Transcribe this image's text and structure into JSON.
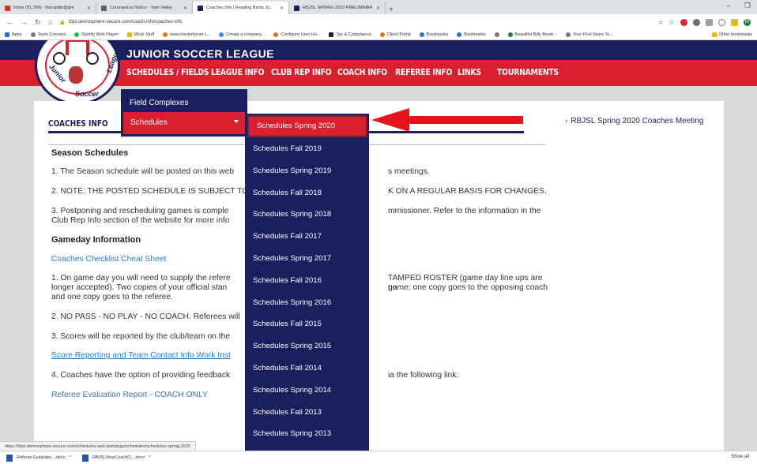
{
  "browser": {
    "tabs": [
      {
        "title": "Inbox (61,786) - theraddie@gm",
        "color": "#d93025"
      },
      {
        "title": "Coronavirus Notice - Twin Valley",
        "color": "#5f6368"
      },
      {
        "title": "Coaches Info | Reading Berks Ju",
        "color": "#1a1f5e",
        "active": true
      },
      {
        "title": "RBJSL SPRING 2020 PRELIMINAR",
        "color": "#1a1f5e"
      }
    ],
    "new_tab": "+",
    "url": "rbjsl.demosphere-secure.com/coach-info/coaches-info",
    "bookmarks": [
      "Apps",
      "Team Connect",
      "Spotify Web Player",
      "Work Stuff",
      "www.tractorbynet.c...",
      "Create a company...",
      "Configure User Ho...",
      "Tax & Compliance",
      "Client Portal",
      "Bookmarks",
      "Bookmarks",
      "Beautiful Billy Beste...",
      "Your First Steps To...",
      "Other bookmarks"
    ],
    "profile_initial": "M",
    "status_url": "https://rbjsl.demosphere-secure.com/schedules-and-standings/schedules/schedules-spring-2020",
    "downloads": [
      "Referee Evaluatio....docx",
      "RBJSLNewCoachO....docx"
    ],
    "show_all": "Show all"
  },
  "site": {
    "league_name": "JUNIOR SOCCER LEAGUE",
    "logo_text": {
      "junior": "Junior",
      "soccer": "Soccer",
      "league": "League"
    },
    "nav": [
      "SCHEDULES / FIELDS",
      "LEAGUE INFO",
      "CLUB REP INFO",
      "COACH INFO",
      "REFEREE INFO",
      "LINKS",
      "TOURNAMENTS"
    ],
    "dropdown": {
      "field_complexes": "Field Complexes",
      "schedules": "Schedules",
      "submenu": [
        "Schedules Spring 2020",
        "Schedules Fall 2019",
        "Schedules Spring 2019",
        "Schedules Fall 2018",
        "Schedules Spring 2018",
        "Schedules Fall 2017",
        "Schedules Spring 2017",
        "Schedules Fall 2016",
        "Schedules Spring 2016",
        "Schedules Fall 2015",
        "Schedules Spring 2015",
        "Schedules Fall 2014",
        "Schedules Spring 2014",
        "Schedules Fall 2013",
        "Schedules Spring 2013"
      ]
    }
  },
  "content": {
    "page_title": "COACHES INFO",
    "sidebar_link": "RBJSL Spring 2020 Coaches Meeting",
    "season_heading": "Season Schedules",
    "p1": "1. The Season schedule will be posted on this web",
    "p1_end": "s meetings.",
    "p2": "2. NOTE: THE POSTED SCHEDULE IS SUBJECT TO C",
    "p2_end": "K ON A REGULAR BASIS FOR CHANGES.",
    "p3a": "3.  Postponing and rescheduling games is comple",
    "p3a_end": "mmissioner.  Refer to the information in the",
    "p3b": "Club Rep Info section of the website for more info",
    "gameday_heading": "Gameday Information",
    "checklist_link": "Coaches Checklist Cheat Sheet",
    "g1a": "1. On game day you will need to supply the refere",
    "g1a_end": "TAMPED ROSTER (game day line ups are no",
    "g1b": "longer accepted).  Two copies of your official stan",
    "g1b_end": "game;  one copy goes to the opposing coach",
    "g1c": "and one copy goes to the referee.",
    "g2": "2. NO PASS - NO PLAY - NO COACH.  Referees will",
    "g3": "3. Scores will be reported by the club/team on the",
    "score_link": "Score Reporting and Team Contact Info Work Inst",
    "g4": "4.  Coaches have the option of providing feedback",
    "g4_end": "ia the following link:",
    "eval_link": "Referee Evaluation Report - COACH ONLY"
  }
}
